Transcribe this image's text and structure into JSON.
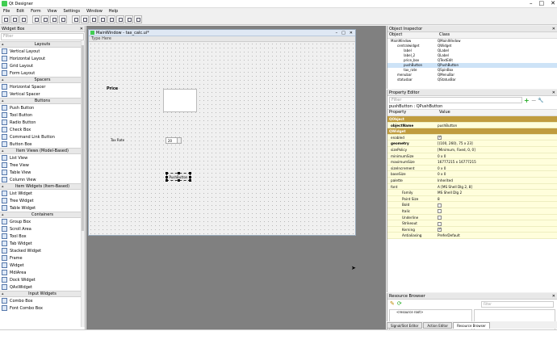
{
  "app": {
    "title": "Qt Designer"
  },
  "menus": [
    "File",
    "Edit",
    "Form",
    "View",
    "Settings",
    "Window",
    "Help"
  ],
  "widget_box": {
    "title": "Widget Box",
    "filter_placeholder": "Filter",
    "sections": [
      {
        "name": "Layouts",
        "items": [
          "Vertical Layout",
          "Horizontal Layout",
          "Grid Layout",
          "Form Layout"
        ]
      },
      {
        "name": "Spacers",
        "items": [
          "Horizontal Spacer",
          "Vertical Spacer"
        ]
      },
      {
        "name": "Buttons",
        "items": [
          "Push Button",
          "Tool Button",
          "Radio Button",
          "Check Box",
          "Command Link Button",
          "Button Box"
        ]
      },
      {
        "name": "Item Views (Model-Based)",
        "items": [
          "List View",
          "Tree View",
          "Table View",
          "Column View"
        ]
      },
      {
        "name": "Item Widgets (Item-Based)",
        "items": [
          "List Widget",
          "Tree Widget",
          "Table Widget"
        ]
      },
      {
        "name": "Containers",
        "items": [
          "Group Box",
          "Scroll Area",
          "Tool Box",
          "Tab Widget",
          "Stacked Widget",
          "Frame",
          "Widget",
          "MdiArea",
          "Dock Widget",
          "QAxWidget"
        ]
      },
      {
        "name": "Input Widgets",
        "items": [
          "Combo Box",
          "Font Combo Box"
        ]
      }
    ]
  },
  "form": {
    "title": "MainWindow - tax_calc.ui*",
    "menu_placeholder": "Type Here",
    "price_label": "Price",
    "tax_label": "Tax Rate",
    "tax_value": "20",
    "button_text": "PushButton"
  },
  "object_inspector": {
    "title": "Object Inspector",
    "headers": [
      "Object",
      "Class"
    ],
    "rows": [
      {
        "object": "MainWindow",
        "class": "QMainWindow",
        "level": 0
      },
      {
        "object": "centralwidget",
        "class": "QWidget",
        "level": 1
      },
      {
        "object": "label",
        "class": "QLabel",
        "level": 2
      },
      {
        "object": "label_2",
        "class": "QLabel",
        "level": 2
      },
      {
        "object": "price_box",
        "class": "QTextEdit",
        "level": 2
      },
      {
        "object": "pushButton",
        "class": "QPushButton",
        "level": 2
      },
      {
        "object": "tax_rate",
        "class": "QSpinBox",
        "level": 2
      },
      {
        "object": "menubar",
        "class": "QMenuBar",
        "level": 1
      },
      {
        "object": "statusbar",
        "class": "QStatusBar",
        "level": 1
      }
    ]
  },
  "property_editor": {
    "title": "Property Editor",
    "filter_placeholder": "Filter",
    "object_line": "pushButton : QPushButton",
    "headers": [
      "Property",
      "Value"
    ],
    "rows": [
      {
        "p": "QObject",
        "v": "",
        "type": "group"
      },
      {
        "p": "objectName",
        "v": "pushButton",
        "type": "bold"
      },
      {
        "p": "QWidget",
        "v": "",
        "type": "group"
      },
      {
        "p": "enabled",
        "v": "",
        "type": "check",
        "checked": true
      },
      {
        "p": "geometry",
        "v": "[(100, 260), 75 x 23]",
        "type": "bold"
      },
      {
        "p": "sizePolicy",
        "v": "[Minimum, Fixed, 0, 0]",
        "type": "normal"
      },
      {
        "p": "minimumSize",
        "v": "0 x 0",
        "type": "normal"
      },
      {
        "p": "maximumSize",
        "v": "16777215 x 16777215",
        "type": "normal"
      },
      {
        "p": "sizeIncrement",
        "v": "0 x 0",
        "type": "normal"
      },
      {
        "p": "baseSize",
        "v": "0 x 0",
        "type": "normal"
      },
      {
        "p": "palette",
        "v": "Inherited",
        "type": "normal"
      },
      {
        "p": "font",
        "v": "A  [MS Shell Dlg 2, 8]",
        "type": "normal"
      },
      {
        "p": "Family",
        "v": "MS Shell Dlg 2",
        "type": "sub"
      },
      {
        "p": "Point Size",
        "v": "8",
        "type": "sub"
      },
      {
        "p": "Bold",
        "v": "",
        "type": "subcheck",
        "checked": false
      },
      {
        "p": "Italic",
        "v": "",
        "type": "subcheck",
        "checked": false
      },
      {
        "p": "Underline",
        "v": "",
        "type": "subcheck",
        "checked": false
      },
      {
        "p": "Strikeout",
        "v": "",
        "type": "subcheck",
        "checked": false
      },
      {
        "p": "Kerning",
        "v": "",
        "type": "subcheck",
        "checked": true
      },
      {
        "p": "Antialiasing",
        "v": "PreferDefault",
        "type": "sub"
      }
    ]
  },
  "resource_browser": {
    "title": "Resource Browser",
    "filter_placeholder": "Filter",
    "root": "<resource root>"
  },
  "tabs": [
    "Signal/Slot Editor",
    "Action Editor",
    "Resource Browser"
  ],
  "colors": {
    "group": "#c09c3e",
    "prop_bg": "#fffedc"
  }
}
